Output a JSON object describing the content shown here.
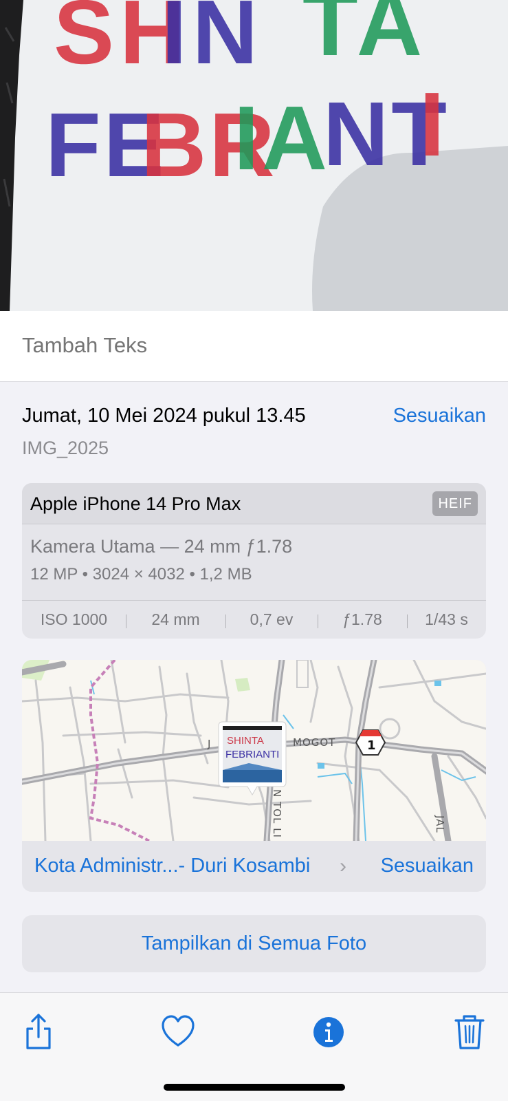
{
  "photo": {
    "line1": "SHINTA",
    "line2": "FEBRIANTI"
  },
  "caption": {
    "placeholder": "Tambah Teks"
  },
  "info": {
    "datetime": "Jumat, 10 Mei 2024 pukul 13.45",
    "adjust_label": "Sesuaikan",
    "filename": "IMG_2025"
  },
  "camera": {
    "model": "Apple iPhone 14 Pro Max",
    "format": "HEIF",
    "lens": "Kamera Utama — 24 mm ƒ1.78",
    "specs": "12 MP  •  3024 × 4032  •  1,2 MB",
    "exif": {
      "iso": "ISO 1000",
      "focal": "24 mm",
      "ev": "0,7 ev",
      "aperture": "ƒ1.78",
      "shutter": "1/43 s"
    }
  },
  "map": {
    "road_label_left": "J",
    "road_label_right": "MOGOT",
    "route_shield": "1",
    "road_label_vertical": "N TOL LI",
    "road_label_vertical2": "JAL",
    "thumb_line1": "SHINTA",
    "thumb_line2": "FEBRIANTI",
    "place": "Kota Administr...- Duri Kosambi",
    "adjust_label": "Sesuaikan"
  },
  "show_all_label": "Tampilkan di Semua Foto",
  "toolbar": {
    "share_icon": "share-icon",
    "favorite_icon": "heart-icon",
    "info_icon": "info-icon",
    "delete_icon": "trash-icon"
  },
  "colors": {
    "accent": "#1a73d9",
    "red_ink": "#d8333f",
    "blue_ink": "#3a2fa3",
    "green_ink": "#1f9a5a"
  }
}
